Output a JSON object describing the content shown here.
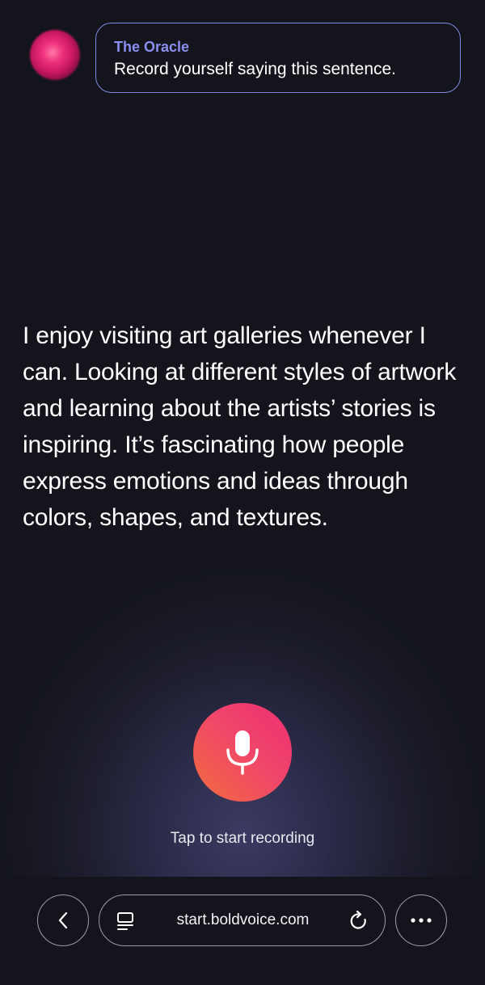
{
  "oracle": {
    "name": "The Oracle",
    "message": "Record yourself saying this sentence."
  },
  "sentence": "I enjoy visiting art galleries whenever I can. Looking at different styles of artwork and learning about the artists’ stories is inspiring. It’s fascinating how people express emotions and ideas through colors, shapes, and textures.",
  "recorder": {
    "label": "Tap to start recording",
    "icon": "microphone-icon",
    "colors": {
      "start": "#f26d3d",
      "end": "#ec2f72"
    }
  },
  "browser": {
    "url": "start.boldvoice.com",
    "icons": [
      "back-arrow-icon",
      "tabs-icon",
      "reload-icon",
      "more-icon"
    ]
  },
  "colors": {
    "background": "#14151c",
    "accent": "#8a8ff0",
    "bubble_border": "#7f88e6"
  }
}
